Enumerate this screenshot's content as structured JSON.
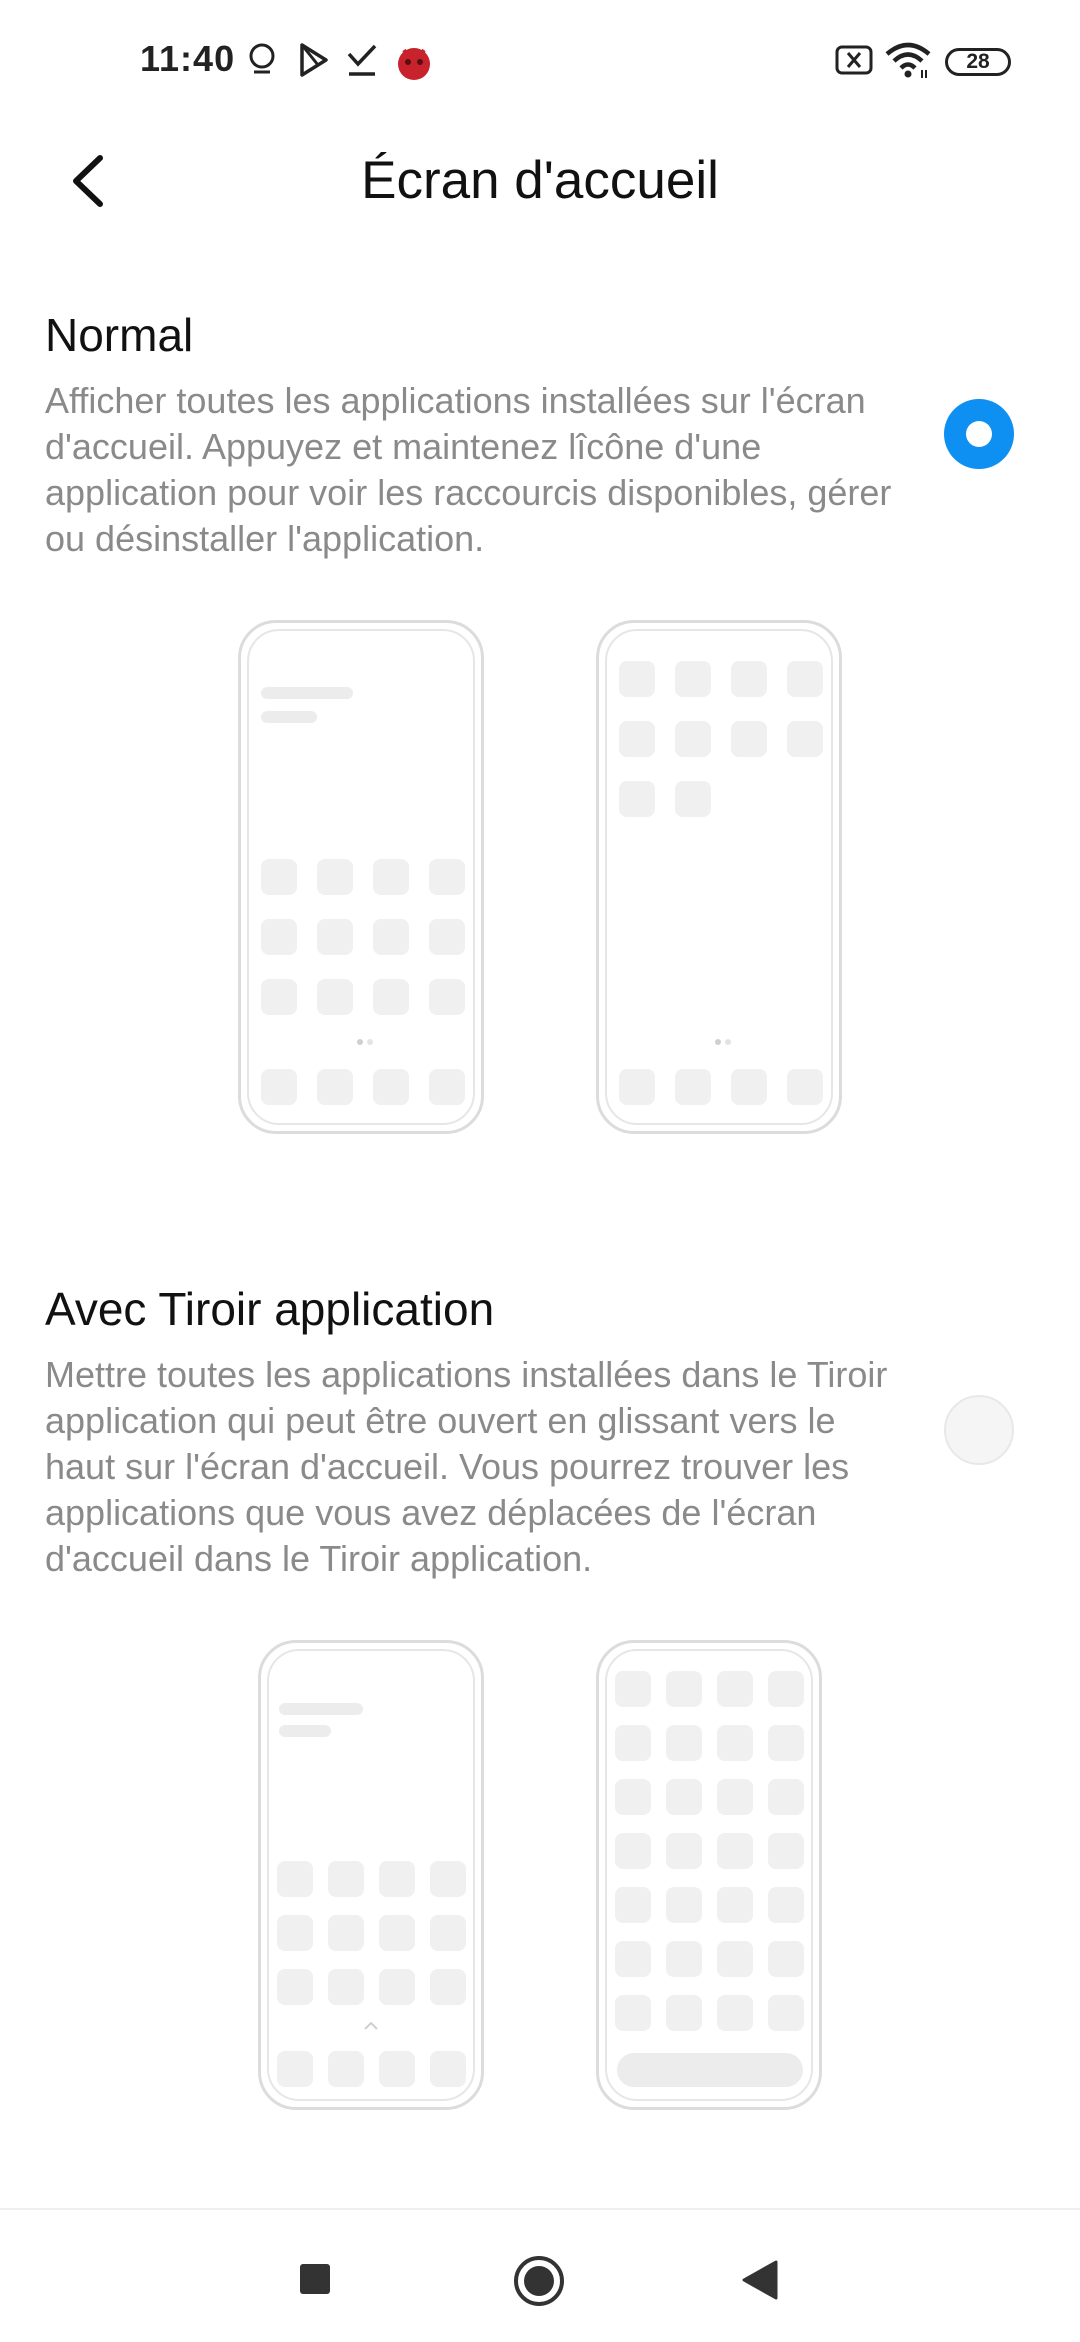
{
  "status_bar": {
    "time": "11:40",
    "icons": [
      "location-pin-icon",
      "play-store-icon",
      "download-done-icon",
      "antutu-app-icon",
      "no-sim-icon",
      "wifi-icon"
    ],
    "battery": "28"
  },
  "header": {
    "title": "Écran d'accueil",
    "back_icon": "chevron-left-icon"
  },
  "options": [
    {
      "title": "Normal",
      "description": "Afficher toutes les applications installées sur l'écran d'accueil. Appuyez et maintenez lîcône d'une application pour voir les raccourcis disponibles, gérer ou désinstaller l'application.",
      "selected": true
    },
    {
      "title": "Avec Tiroir application",
      "description": "Mettre toutes les applications installées dans le Tiroir application qui peut être ouvert en glissant vers le haut sur l'écran d'accueil. Vous pourrez trouver les applications que vous avez déplacées de l'écran d'accueil dans le Tiroir application.",
      "selected": false
    }
  ],
  "nav_bar": {
    "buttons": [
      "recents-square-icon",
      "home-circle-icon",
      "back-triangle-icon"
    ]
  },
  "colors": {
    "accent": "#0e8ff2",
    "description_text": "#8a8a8a",
    "mockup_outline": "#dcdcdc"
  }
}
